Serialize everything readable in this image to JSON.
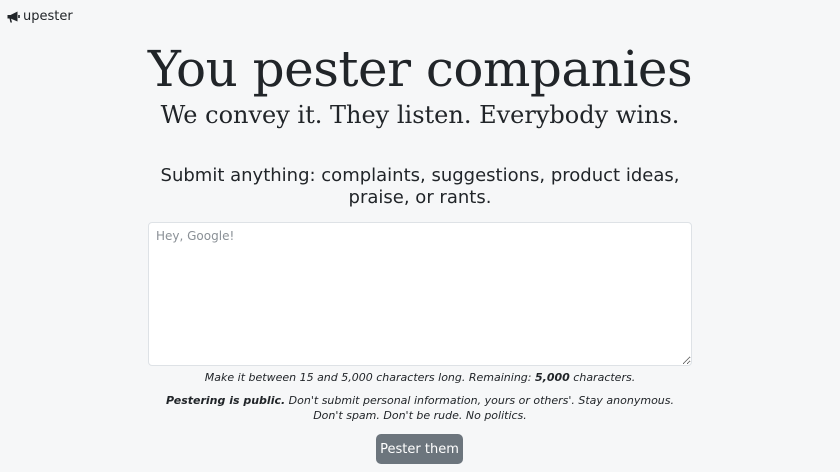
{
  "brand": {
    "name": "upester",
    "icon": "megaphone-icon"
  },
  "hero": {
    "title": "You pester companies",
    "subtitle": "We convey it. They listen. Everybody wins."
  },
  "form": {
    "prompt": "Submit anything: complaints, suggestions, product ideas, praise, or rants.",
    "textarea": {
      "placeholder": "Hey, Google!",
      "value": ""
    },
    "hint": {
      "before": "Make it between 15 and 5,000 characters long. Remaining: ",
      "remaining": "5,000",
      "after": " characters."
    },
    "rules": {
      "emphasis": "Pestering is public.",
      "text": " Don't submit personal information, yours or others'. Stay anonymous. Don't spam. Don't be rude. No politics."
    },
    "submit_label": "Pester them"
  },
  "colors": {
    "background": "#f6f7f8",
    "text": "#212529",
    "button": "#6c757d",
    "button_text": "#ffffff",
    "input_border": "#dee2e6"
  }
}
